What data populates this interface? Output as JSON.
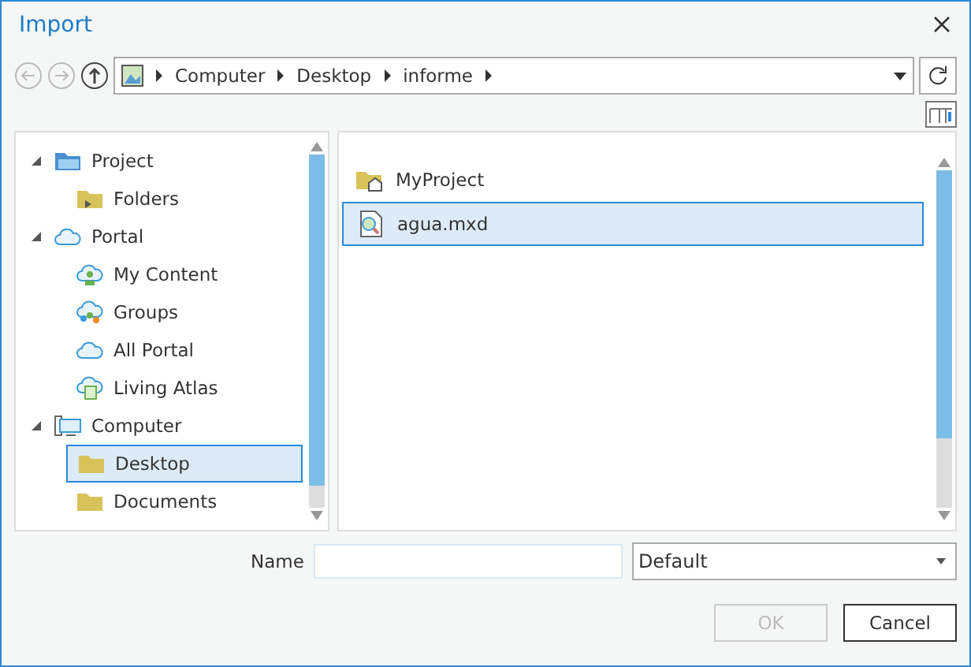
{
  "window": {
    "title": "Import"
  },
  "breadcrumb": [
    "Computer",
    "Desktop",
    "informe"
  ],
  "tree": [
    {
      "label": "Project",
      "kind": "project",
      "expanded": true,
      "selected": false,
      "children": [
        {
          "label": "Folders",
          "kind": "folders",
          "selected": false
        }
      ]
    },
    {
      "label": "Portal",
      "kind": "portal",
      "expanded": true,
      "selected": false,
      "children": [
        {
          "label": "My Content",
          "kind": "my-content",
          "selected": false
        },
        {
          "label": "Groups",
          "kind": "groups",
          "selected": false
        },
        {
          "label": "All Portal",
          "kind": "portal",
          "selected": false
        },
        {
          "label": "Living Atlas",
          "kind": "atlas",
          "selected": false
        }
      ]
    },
    {
      "label": "Computer",
      "kind": "computer",
      "expanded": true,
      "selected": false,
      "children": [
        {
          "label": "Desktop",
          "kind": "folder",
          "selected": true
        },
        {
          "label": "Documents",
          "kind": "folder",
          "selected": false
        }
      ]
    }
  ],
  "files": [
    {
      "name": "MyProject",
      "kind": "home-folder",
      "selected": false
    },
    {
      "name": "agua.mxd",
      "kind": "map-document",
      "selected": true
    }
  ],
  "name_field": {
    "label": "Name"
  },
  "filter": {
    "value": "Default"
  },
  "buttons": [
    {
      "label": "OK",
      "disabled": true
    },
    {
      "label": "Cancel",
      "disabled": false
    }
  ]
}
